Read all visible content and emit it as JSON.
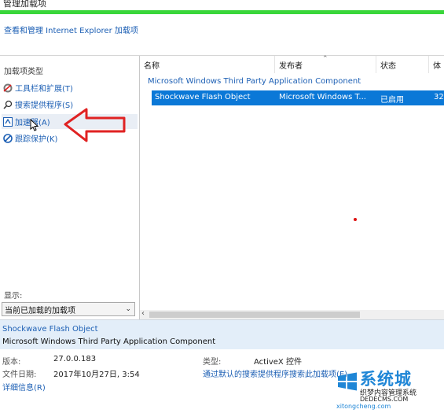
{
  "window": {
    "title": "管理加载项"
  },
  "header": {
    "link": "查看和管理 Internet Explorer 加载项"
  },
  "sidebar": {
    "title": "加载项类型",
    "items": [
      {
        "label": "工具栏和扩展(T)",
        "icon": "toolbar-gear-icon"
      },
      {
        "label": "搜索提供程序(S)",
        "icon": "search-icon"
      },
      {
        "label": "加速器(A)",
        "icon": "accelerator-icon"
      },
      {
        "label": "跟踪保护(K)",
        "icon": "tracking-protection-icon"
      }
    ],
    "show_label": "显示:",
    "show_value": "当前已加载的加载项"
  },
  "columns": [
    "名称",
    "发布者",
    "状态",
    "体"
  ],
  "group": "Microsoft Windows Third Party Application Component",
  "selected_row": {
    "name": "Shockwave Flash Object",
    "publisher": "Microsoft Windows T...",
    "status": "已启用",
    "extra": "32"
  },
  "details": {
    "name": "Shockwave Flash Object",
    "publisher": "Microsoft Windows Third Party Application Component",
    "version_label": "版本:",
    "version": "27.0.0.183",
    "date_label": "文件日期:",
    "date": "2017年10月27日, 3:54",
    "more_info": "详细信息(R)",
    "type_label": "类型:",
    "type": "ActiveX 控件",
    "search_link": "通过默认的搜索提供程序搜索此加载项(E)"
  },
  "watermark": {
    "brand": "系统城",
    "line2": "织梦内容管理系统",
    "line3": "DEDECMS.COM",
    "line4": "xitongcheng.com"
  },
  "colors": {
    "accent": "#0b78d7",
    "green": "#39d63a",
    "annotation_red": "#e02222",
    "link": "#1c5fb4"
  }
}
